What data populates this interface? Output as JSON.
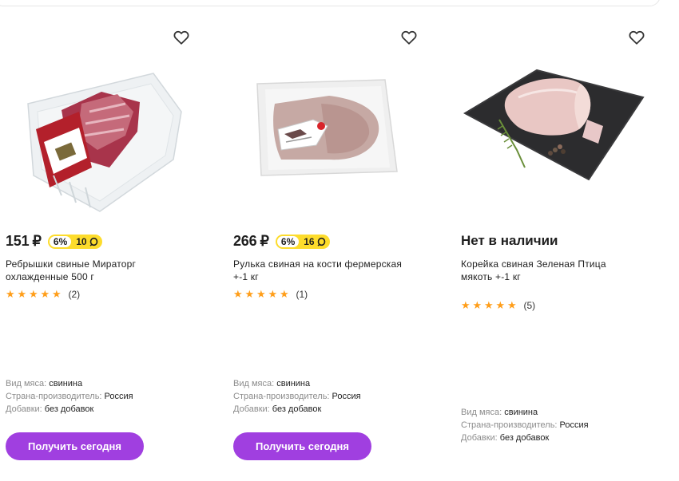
{
  "colors": {
    "accent": "#a03fe0",
    "star": "#ff9e1a",
    "bonus": "#fddc2c"
  },
  "icons": {
    "favorite": "heart-outline-icon",
    "star": "star-icon",
    "bonus_points": "bonus-points-icon"
  },
  "products": [
    {
      "price": "151",
      "currency": "₽",
      "bonus_percent": "6%",
      "bonus_points": "10",
      "name_line1": "Ребрышки свиные Мираторг",
      "name_line2": "охлажденные 500 г",
      "reviews": "(2)",
      "rating": 5,
      "props": [
        {
          "key": "Вид мяса:",
          "value": "свинина"
        },
        {
          "key": "Страна-производитель:",
          "value": "Россия"
        },
        {
          "key": "Добавки:",
          "value": "без добавок"
        }
      ],
      "button": "Получить сегодня"
    },
    {
      "price": "266",
      "currency": "₽",
      "bonus_percent": "6%",
      "bonus_points": "16",
      "name_line1": "Рулька свиная на кости фермерская",
      "name_line2": "+-1 кг",
      "reviews": "(1)",
      "rating": 5,
      "props": [
        {
          "key": "Вид мяса:",
          "value": "свинина"
        },
        {
          "key": "Страна-производитель:",
          "value": "Россия"
        },
        {
          "key": "Добавки:",
          "value": "без добавок"
        }
      ],
      "button": "Получить сегодня"
    },
    {
      "status": "Нет в наличии",
      "name_line1": "Корейка свиная Зеленая Птица",
      "name_line2": "мякоть +-1 кг",
      "reviews": "(5)",
      "rating": 5,
      "props": [
        {
          "key": "Вид мяса:",
          "value": "свинина"
        },
        {
          "key": "Страна-производитель:",
          "value": "Россия"
        },
        {
          "key": "Добавки:",
          "value": "без добавок"
        }
      ]
    }
  ]
}
